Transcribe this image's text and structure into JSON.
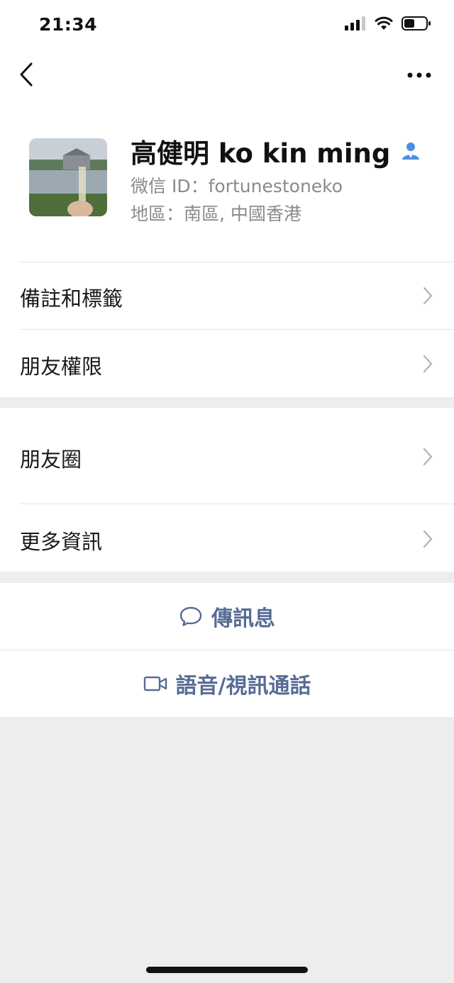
{
  "status_bar": {
    "time": "21:34",
    "icons": [
      "signal-icon",
      "wifi-icon",
      "battery-icon"
    ]
  },
  "nav": {
    "back_icon": "chevron-left-icon",
    "more_icon": "more-dots-icon"
  },
  "profile": {
    "name": "高健明 ko kin ming",
    "wechat_id": "微信 ID：fortunestoneko",
    "region": "地區：南區, 中國香港",
    "verified_icon": "person-verified-icon"
  },
  "list_group_1": [
    {
      "label": "備註和標籤"
    },
    {
      "label": "朋友權限"
    }
  ],
  "list_group_2": [
    {
      "label": "朋友圈"
    },
    {
      "label": "更多資訊"
    }
  ],
  "actions": [
    {
      "label": "傳訊息",
      "icon": "chat-bubble-icon"
    },
    {
      "label": "語音/視訊通話",
      "icon": "video-camera-icon"
    }
  ],
  "colors": {
    "link_blue": "#576b95",
    "verified_blue": "#4a90e2",
    "background": "#ededed"
  }
}
